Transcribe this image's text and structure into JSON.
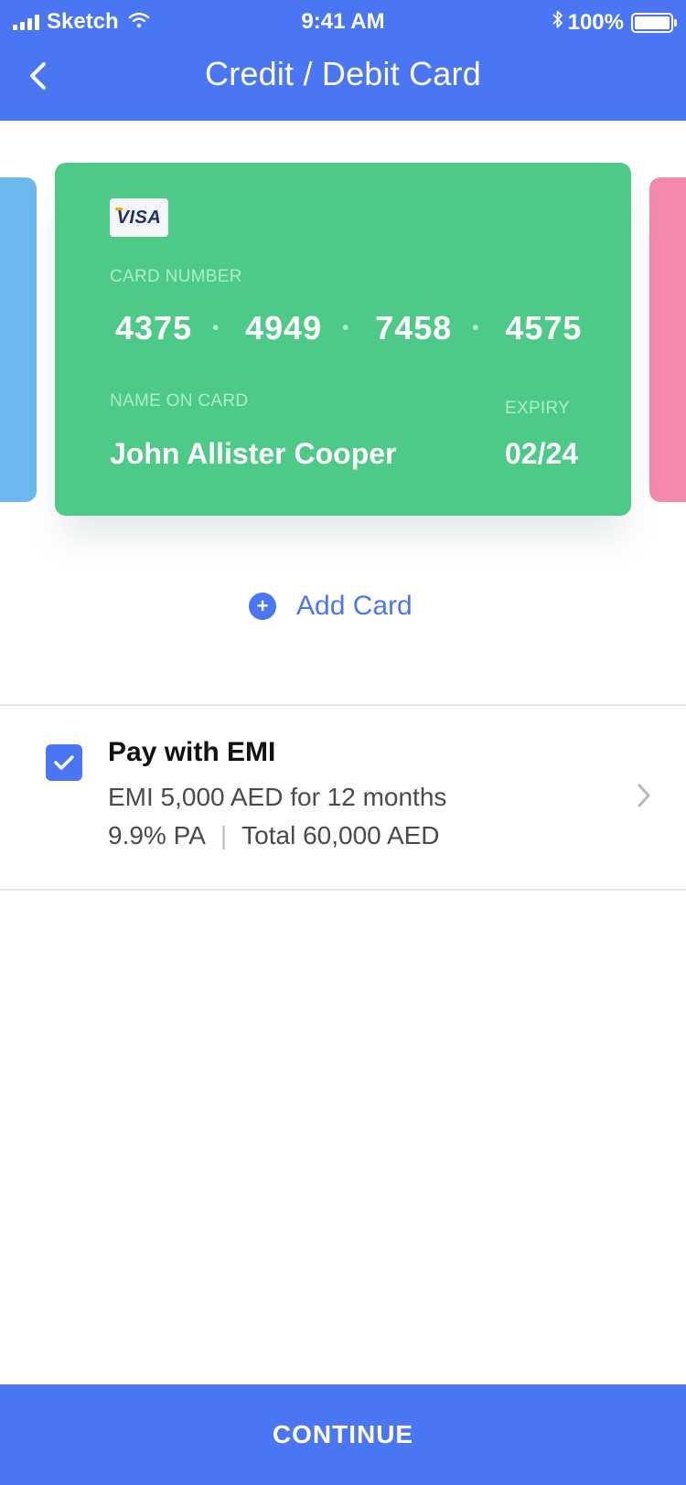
{
  "status_bar": {
    "carrier": "Sketch",
    "time": "9:41 AM",
    "battery": "100%"
  },
  "header": {
    "title": "Credit / Debit Card"
  },
  "card": {
    "brand": "VISA",
    "number_label": "CARD NUMBER",
    "number_groups": [
      "4375",
      "4949",
      "7458",
      "4575"
    ],
    "name_label": "NAME ON CARD",
    "name": "John Allister Cooper",
    "expiry_label": "EXPIRY",
    "expiry": "02/24",
    "color": "#4DC988"
  },
  "side_cards": {
    "left_color": "#6BB8EE",
    "right_color": "#F38AAD"
  },
  "add_card": {
    "label": "Add Card"
  },
  "emi": {
    "checked": true,
    "title": "Pay with EMI",
    "line1": "EMI 5,000 AED for 12 months",
    "rate": "9.9% PA",
    "separator": "|",
    "total": "Total 60,000 AED"
  },
  "footer": {
    "continue_label": "CONTINUE"
  },
  "colors": {
    "accent": "#4A76F3"
  }
}
